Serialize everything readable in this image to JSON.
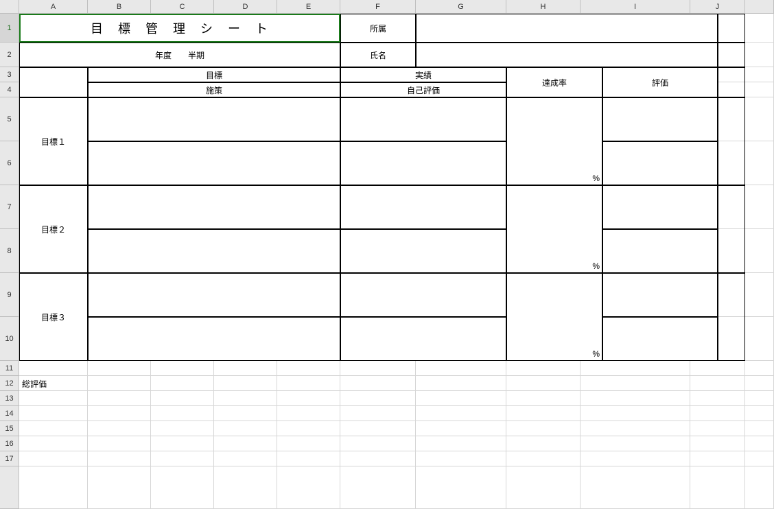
{
  "columns": [
    "A",
    "B",
    "C",
    "D",
    "E",
    "F",
    "G",
    "H",
    "I",
    "J"
  ],
  "rows": [
    "1",
    "2",
    "3",
    "4",
    "5",
    "6",
    "7",
    "8",
    "9",
    "10",
    "11",
    "12",
    "13",
    "14",
    "15",
    "16",
    "17"
  ],
  "title": "目　標　管　理　シ　ー　ト",
  "header": {
    "affiliation_label": "所属",
    "name_label": "氏名",
    "year_term": "年度　　半期"
  },
  "section_headers": {
    "goal": "目標",
    "result": "実績",
    "measure": "施策",
    "self_eval": "自己評価",
    "achieve_rate": "達成率",
    "evaluation": "評価"
  },
  "goals": [
    {
      "label": "目標１",
      "percent": "%"
    },
    {
      "label": "目標２",
      "percent": "%"
    },
    {
      "label": "目標３",
      "percent": "%"
    }
  ],
  "overall_label": "総評価"
}
